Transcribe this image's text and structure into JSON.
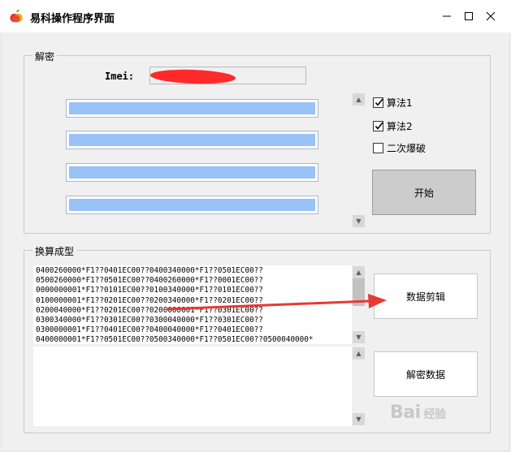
{
  "window": {
    "title": "易科操作程序界面",
    "icon": "apple-icon",
    "controls": [
      "minimize-icon",
      "maximize-icon",
      "close-icon"
    ]
  },
  "decrypt_group": {
    "label": "解密",
    "imei_label": "Imei:",
    "imei_value": "",
    "fields": [
      "",
      "",
      "",
      ""
    ],
    "options": [
      {
        "label": "算法1",
        "checked": true
      },
      {
        "label": "算法2",
        "checked": true
      },
      {
        "label": "二次爆破",
        "checked": false
      }
    ],
    "start_button": "开始"
  },
  "convert_group": {
    "label": "换算成型",
    "lines": [
      "0400260000*F1??0401EC00??0400340000*F1??0501EC00??",
      "0500260000*F1??0501EC00??0400260000*F1??0001EC00??",
      "0000000001*F1??0101EC00??0100340000*F1??0101EC00??",
      "0100000001*F1??0201EC00??0200340000*F1??0201EC00??",
      "0200040000*F1??0201EC00??0200000001*F1??0301EC00??",
      "0300340000*F1??0301EC00??0300040000*F1??0301EC00??",
      "0300000001*F1??0401EC00??0400040000*F1??0401EC00??",
      "0400000001*F1??0501EC00??0500340000*F1??0501EC00??0500040000*"
    ],
    "output_value": "",
    "clip_button": "数据剪辑",
    "decrypt_button": "解密数据"
  },
  "annotation": {
    "arrow_color": "#e53935",
    "redaction_color": "#ff2a2a"
  },
  "watermark": {
    "text": "Bai",
    "suffix": "经验"
  }
}
